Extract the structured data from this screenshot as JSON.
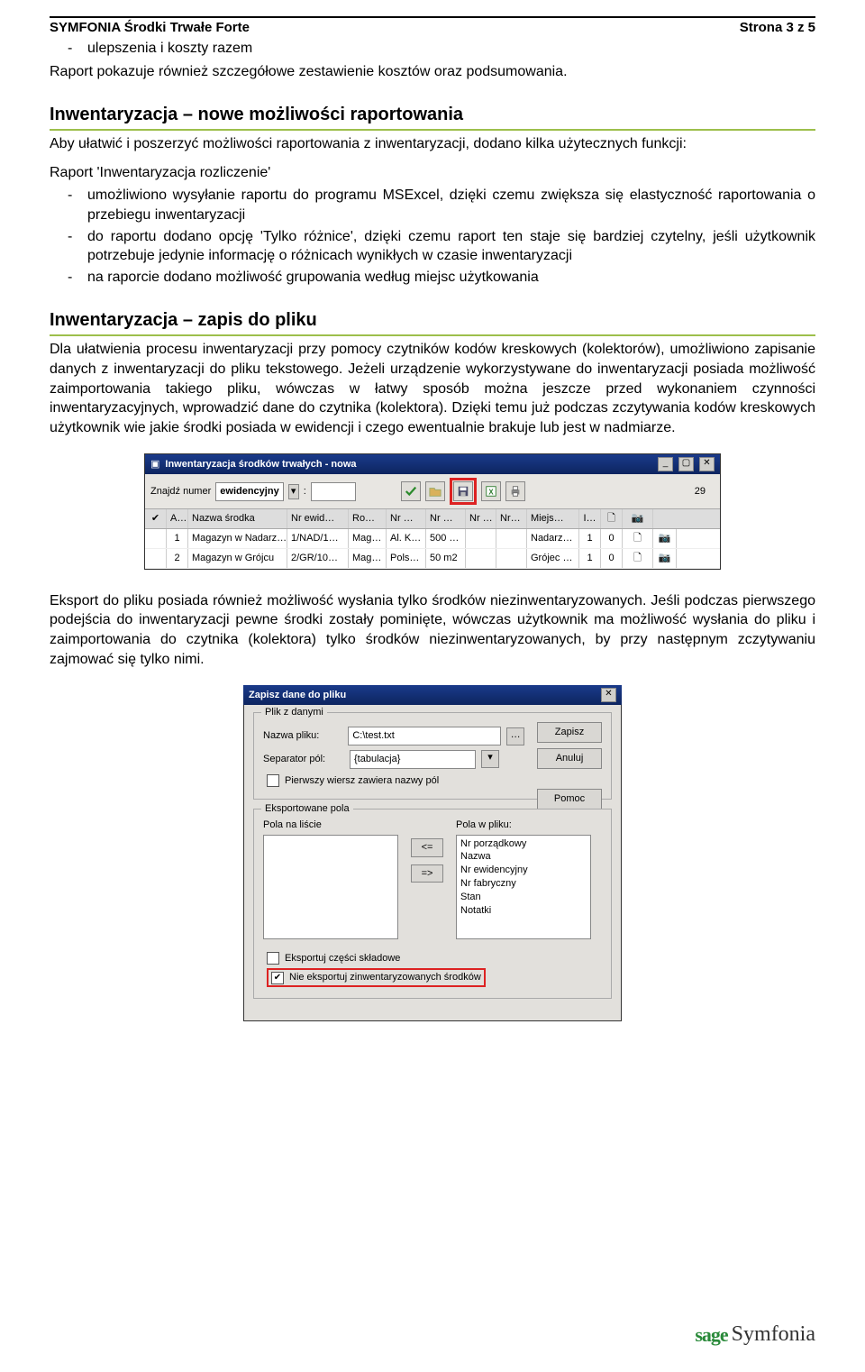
{
  "header": {
    "product": "SYMFONIA Środki Trwałe Forte",
    "page": "Strona 3 z 5"
  },
  "intro": {
    "bullet": "ulepszenia i koszty razem",
    "after": "Raport pokazuje również szczegółowe zestawienie kosztów oraz podsumowania."
  },
  "sec1": {
    "title": "Inwentaryzacja – nowe możliwości raportowania",
    "lead": "Aby ułatwić i poszerzyć możliwości raportowania z inwentaryzacji, dodano kilka użytecznych funkcji:",
    "sub": "Raport 'Inwentaryzacja rozliczenie'",
    "items": [
      "umożliwiono wysyłanie raportu do programu MSExcel, dzięki czemu zwiększa się elastyczność raportowania o przebiegu inwentaryzacji",
      "do raportu dodano opcję 'Tylko różnice', dzięki czemu raport ten staje się bardziej czytelny, jeśli użytkownik potrzebuje jedynie informację o różnicach wynikłych w czasie inwentaryzacji",
      "na raporcie dodano możliwość grupowania według miejsc użytkowania"
    ]
  },
  "sec2": {
    "title": "Inwentaryzacja – zapis do pliku",
    "p1": "Dla ułatwienia procesu inwentaryzacji przy pomocy czytników kodów kreskowych (kolektorów), umożliwiono zapisanie danych z inwentaryzacji do pliku tekstowego. Jeżeli urządzenie wykorzystywane do inwentaryzacji posiada możliwość zaimportowania takiego pliku, wówczas w łatwy sposób można jeszcze przed wykonaniem czynności inwentaryzacyjnych, wprowadzić dane do czytnika (kolektora). Dzięki temu już podczas zczytywania kodów kreskowych użytkownik wie jakie środki posiada w ewidencji i czego ewentualnie brakuje lub jest w nadmiarze.",
    "p2": "Eksport do pliku posiada również możliwość wysłania tylko środków niezinwentaryzowanych. Jeśli podczas pierwszego podejścia do inwentaryzacji pewne środki zostały pominięte, wówczas użytkownik ma możliwość wysłania do pliku i zaimportowania do czytnika (kolektora) tylko środków niezinwentaryzowanych, by przy następnym zczytywaniu zajmować się tylko nimi."
  },
  "shot1": {
    "title": "Inwentaryzacja środków trwałych - nowa",
    "find_label": "Znajdź numer",
    "find_type": "ewidencyjny",
    "count": "29",
    "columns": [
      "✔",
      "A…",
      "Nazwa środka",
      "Nr ewid…",
      "Ro…",
      "Nr …",
      "Nr …",
      "Nr …",
      "Nr…",
      "Miejs…",
      "I…",
      "🗋",
      "📷"
    ],
    "rows": [
      {
        "n": "1",
        "name": "Magazyn w Nadarz…",
        "ev": "1/NAD/1…",
        "ro": "Mag…",
        "c1": "Al. K…",
        "c2": "500 …",
        "c3": "",
        "c4": "",
        "loc": "Nadarz…",
        "i": "1",
        "z": "0"
      },
      {
        "n": "2",
        "name": "Magazyn w Grójcu",
        "ev": "2/GR/10…",
        "ro": "Mag…",
        "c1": "Pols…",
        "c2": "50 m2",
        "c3": "",
        "c4": "",
        "loc": "Grójec …",
        "i": "1",
        "z": "0"
      }
    ]
  },
  "shot2": {
    "title": "Zapisz dane do pliku",
    "grp1": "Plik z danymi",
    "fname_label": "Nazwa pliku:",
    "fname": "C:\\test.txt",
    "sep_label": "Separator pól:",
    "sep": "{tabulacja}",
    "firstrow": "Pierwszy wiersz zawiera nazwy pól",
    "btn_save": "Zapisz",
    "btn_cancel": "Anuluj",
    "btn_help": "Pomoc",
    "grp2": "Eksportowane pola",
    "left_label": "Pola na liście",
    "right_label": "Pola w pliku:",
    "right_items": [
      "Nr porządkowy",
      "Nazwa",
      "Nr ewidencyjny",
      "Nr fabryczny",
      "Stan",
      "Notatki"
    ],
    "chk1": "Eksportuj części składowe",
    "chk2": "Nie eksportuj zinwentaryzowanych środków"
  },
  "footer": {
    "sage": "sage",
    "symfonia": "Symfonia"
  }
}
